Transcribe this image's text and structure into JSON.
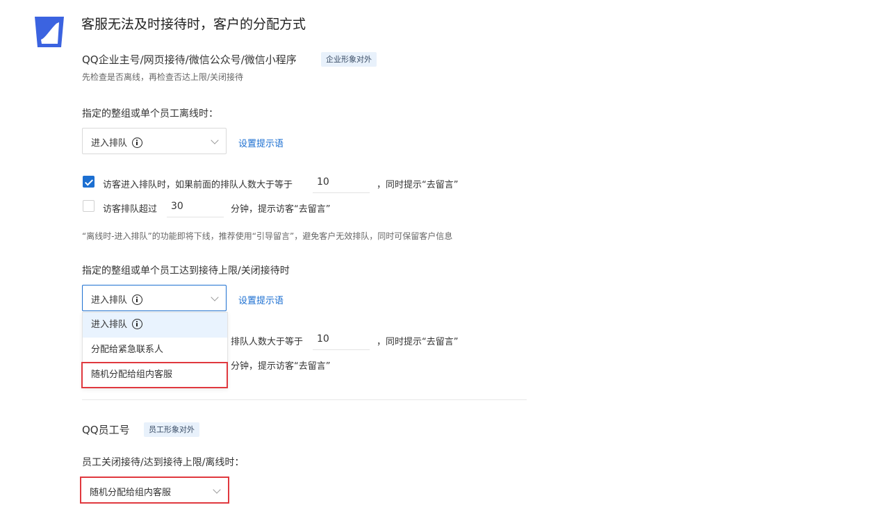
{
  "header": {
    "title": "客服无法及时接待时，客户的分配方式",
    "logo_icon": "bucket-logo-icon"
  },
  "enterprise": {
    "title": "QQ企业主号/网页接待/微信公众号/微信小程序",
    "tag": "企业形象对外",
    "hint": "先检查是否离线，再检查否达上限/关闭接待",
    "offline": {
      "label": "指定的整组或单个员工离线时：",
      "select_value": "进入排队",
      "set_prompt_link": "设置提示语",
      "queue_rule": {
        "checked": true,
        "prefix": "访客进入排队时，如果前面的排队人数大于等于",
        "value": "10",
        "suffix": "，同时提示“去留言”"
      },
      "timeout_rule": {
        "checked": false,
        "prefix": "访客排队超过",
        "value": "30",
        "suffix": "分钟，提示访客“去留言”"
      },
      "notice": "“离线时-进入排队”的功能即将下线，推荐使用“引导留言”，避免客户无效排队，同时可保留客户信息"
    },
    "limit": {
      "label": "指定的整组或单个员工达到接待上限/关闭接待时",
      "select_value": "进入排队",
      "set_prompt_link": "设置提示语",
      "queue_rule_partial": {
        "prefix": "排队人数大于等于",
        "value": "10",
        "suffix": "，同时提示“去留言”"
      },
      "timeout_rule_partial": {
        "suffix": "分钟，提示访客“去留言”"
      },
      "options": [
        "进入排队",
        "分配给紧急联系人",
        "随机分配给组内客服"
      ]
    }
  },
  "employee": {
    "title": "QQ员工号",
    "tag": "员工形象对外",
    "label": "员工关闭接待/达到接待上限/离线时：",
    "select_value": "随机分配给组内客服"
  },
  "colors": {
    "accent": "#1c6fd1",
    "highlight_border": "#e0383e",
    "tag_bg": "#e8f1fb"
  }
}
